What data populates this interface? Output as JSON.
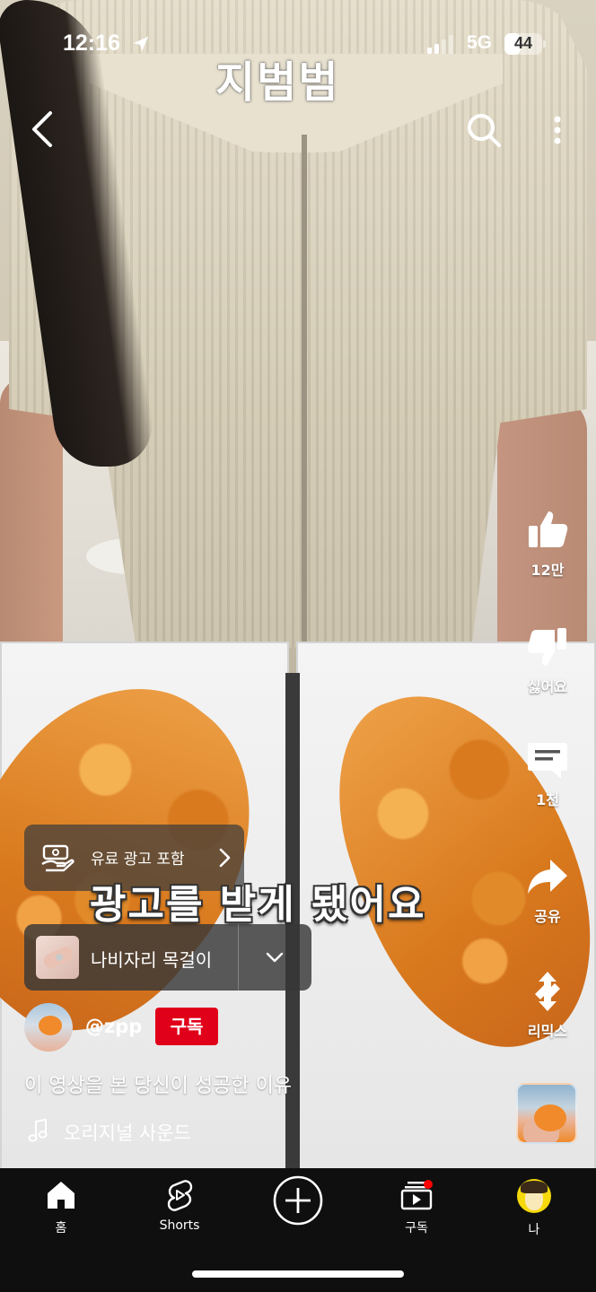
{
  "status_bar": {
    "time": "12:16",
    "network": "5G",
    "battery": "44",
    "battery_level": 0.44
  },
  "video": {
    "channel_overlay_text": "지범범",
    "caption": "광고를 받게 됐어요"
  },
  "top_controls": {
    "back_icon": "chevron-left-icon",
    "search_icon": "search-icon",
    "more_icon": "more-vertical-icon"
  },
  "actions": {
    "like_count": "12만",
    "dislike_label": "싫어요",
    "comment_count": "1천",
    "share_label": "공유",
    "remix_label": "리믹스"
  },
  "ad": {
    "label": "유료 광고 포함"
  },
  "product": {
    "name": "나비자리 목걸이"
  },
  "channel": {
    "handle": "@zpp",
    "subscribe_label": "구독"
  },
  "short": {
    "title": "이 영상을 본 당신이 성공한 이유",
    "sound": "오리지널 사운드"
  },
  "bottom_nav": {
    "home": "홈",
    "shorts": "Shorts",
    "subscriptions": "구독",
    "me": "나"
  },
  "colors": {
    "subscribe_red": "#e1001a",
    "notification_dot": "#ff0000",
    "nav_background": "#0f0f0f"
  }
}
